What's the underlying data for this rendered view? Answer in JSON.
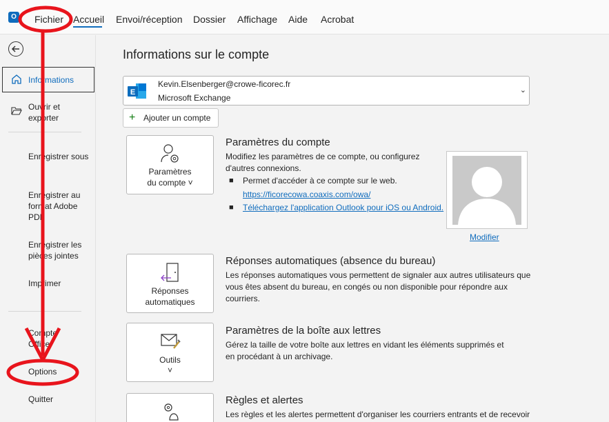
{
  "ribbon": {
    "app_icon": "O",
    "tabs": [
      "Fichier",
      "Accueil",
      "Envoi/réception",
      "Dossier",
      "Affichage",
      "Aide",
      "Acrobat"
    ]
  },
  "sidebar": {
    "back_icon": "back-arrow-icon",
    "items": [
      {
        "label": "Informations",
        "icon": "home-icon"
      },
      {
        "label": "Ouvrir et exporter",
        "icon": "folder-open-icon"
      },
      {
        "label": "Enregistrer sous"
      },
      {
        "label": "Enregistrer au format Adobe PDF"
      },
      {
        "label": "Enregistrer les pièces jointes"
      },
      {
        "label": "Imprimer"
      },
      {
        "label": "Compte Office"
      },
      {
        "label": "Options"
      },
      {
        "label": "Quitter"
      }
    ]
  },
  "main": {
    "title": "Informations sur le compte",
    "account": {
      "email": "Kevin.Elsenberger@crowe-ficorec.fr",
      "type": "Microsoft Exchange"
    },
    "add_account_label": "Ajouter un compte",
    "sections": [
      {
        "card_label_1": "Paramètres",
        "card_label_2": "du compte ˅",
        "title": "Paramètres du compte",
        "desc": "Modifiez les paramètres de ce compte, ou configurez d'autres connexions.",
        "bullets": [
          "Permet d'accéder à ce compte sur le web.",
          "https://ficorecowa.coaxis.com/owa/",
          "Téléchargez l'application Outlook pour iOS ou Android."
        ]
      },
      {
        "card_label_1": "Réponses",
        "card_label_2": "automatiques",
        "title": "Réponses automatiques (absence du bureau)",
        "desc": "Les réponses automatiques vous permettent de signaler aux autres utilisateurs que vous êtes absent du bureau, en congés ou non disponible pour répondre aux courriers."
      },
      {
        "card_label_1": "Outils",
        "card_label_2": "˅",
        "title": "Paramètres de la boîte aux lettres",
        "desc": "Gérez la taille de votre boîte aux lettres en vidant les éléments supprimés et en procédant à un archivage."
      },
      {
        "title": "Règles et alertes",
        "desc": "Les règles et les alertes permettent d'organiser les courriers entrants et de recevoir"
      }
    ],
    "photo_action": "Modifier"
  },
  "colors": {
    "accent": "#0f6cbd",
    "annotation": "#e8141c",
    "exchange_logo": "#0a6cbd"
  }
}
